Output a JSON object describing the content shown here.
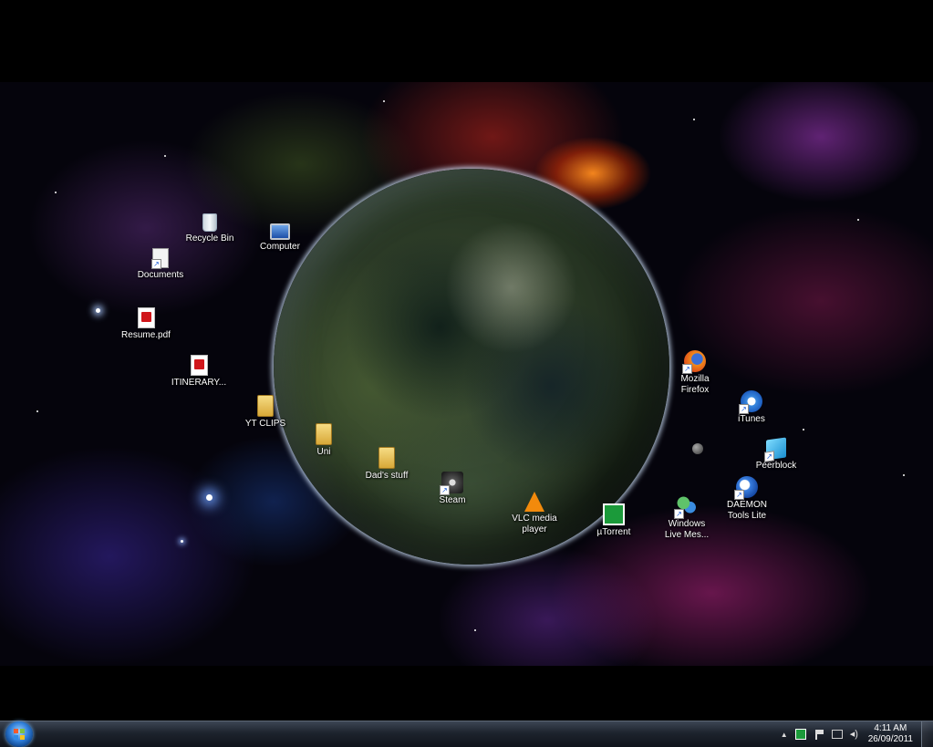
{
  "desktop": {
    "icons": [
      {
        "label": "Recycle Bin",
        "icon": "recycle-bin-icon"
      },
      {
        "label": "Computer",
        "icon": "computer-icon"
      },
      {
        "label": "Documents",
        "icon": "documents-icon"
      },
      {
        "label": "Resume.pdf",
        "icon": "pdf-icon"
      },
      {
        "label": "ITINERARY...",
        "icon": "pdf-icon"
      },
      {
        "label": "YT CLIPS",
        "icon": "folder-icon"
      },
      {
        "label": "Uni",
        "icon": "folder-icon"
      },
      {
        "label": "Dad's stuff",
        "icon": "folder-icon"
      },
      {
        "label": "Steam",
        "icon": "steam-icon"
      },
      {
        "label": "VLC media player",
        "icon": "vlc-icon"
      },
      {
        "label": "µTorrent",
        "icon": "utorrent-icon"
      },
      {
        "label": "Mozilla Firefox",
        "icon": "firefox-icon"
      },
      {
        "label": "iTunes",
        "icon": "itunes-icon"
      },
      {
        "label": "Peerblock",
        "icon": "peerblock-icon"
      },
      {
        "label": "DAEMON Tools Lite",
        "icon": "daemon-tools-icon"
      },
      {
        "label": "Windows Live Mes...",
        "icon": "windows-live-messenger-icon"
      }
    ]
  },
  "taskbar": {
    "clock": {
      "time": "4:11 AM",
      "date": "26/09/2011"
    },
    "tray_icons": [
      "show-hidden-icons-chevron",
      "utorrent-tray-icon",
      "action-center-flag-icon",
      "network-icon",
      "volume-icon"
    ]
  }
}
